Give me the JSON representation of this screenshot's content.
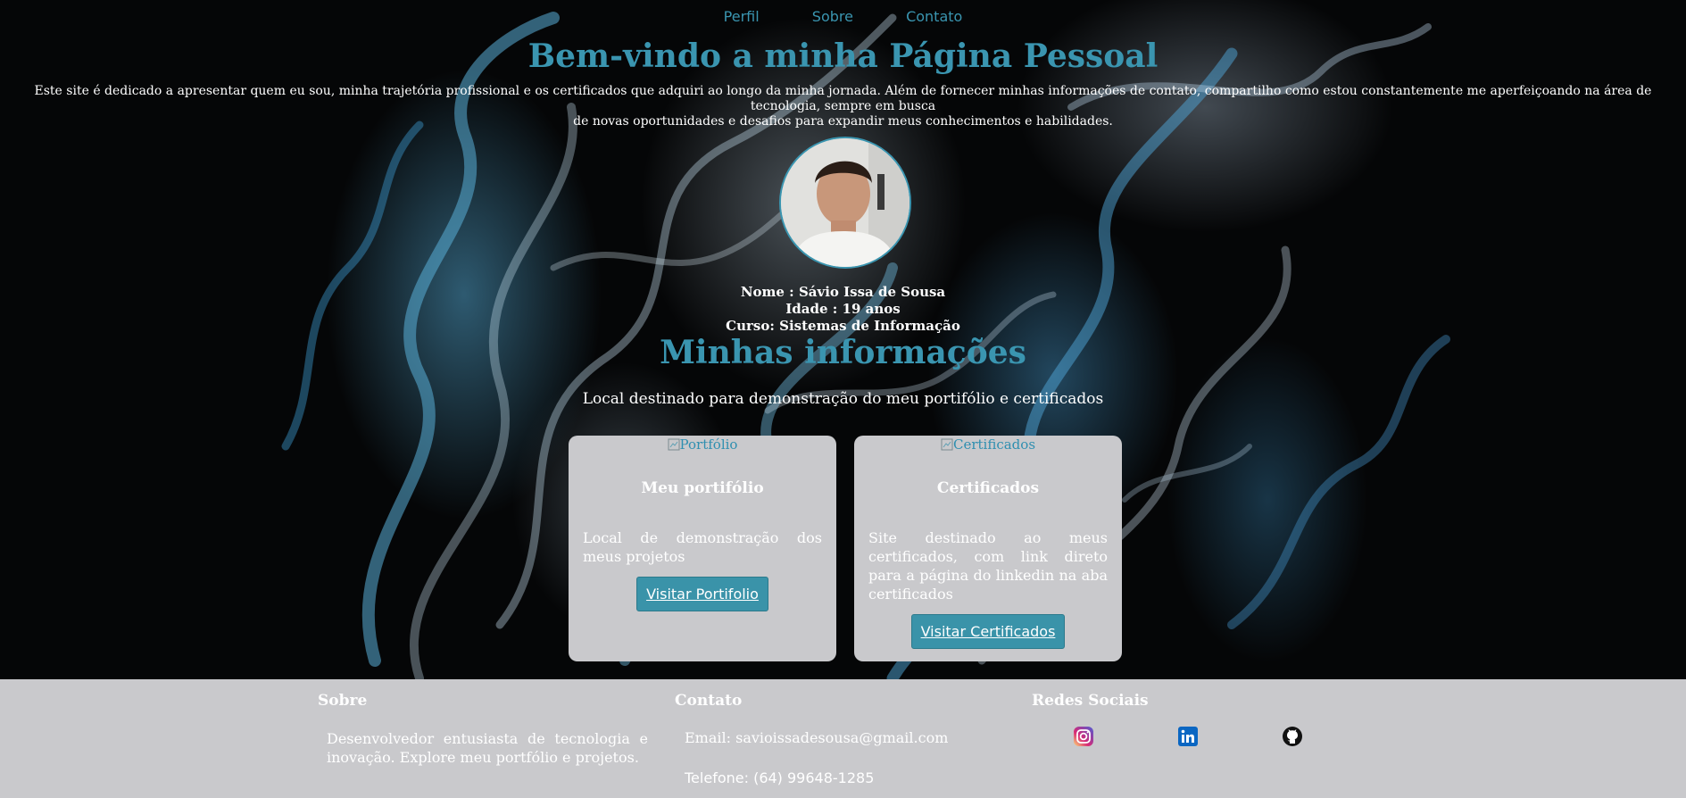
{
  "nav": {
    "items": [
      "Perfil",
      "Sobre",
      "Contato"
    ]
  },
  "hero": {
    "title": "Bem-vindo a minha Página Pessoal",
    "intro_line1": "Este site é dedicado a apresentar quem eu sou, minha trajetória profissional e os certificados que adquiri ao longo da minha jornada. Além de fornecer minhas informações de contato, compartilho como estou constantemente me aperfeiçoando na área de tecnologia, sempre em busca",
    "intro_line2": "de novas oportunidades e desafios para expandir meus conhecimentos e habilidades."
  },
  "profile": {
    "name": "Nome : Sávio Issa de Sousa",
    "age": "Idade : 19 anos",
    "course": "Curso: Sistemas de Informação"
  },
  "section": {
    "title": "Minhas informações",
    "subtitle": "Local destinado para demonstração do meu portifólio e certificados"
  },
  "cards": [
    {
      "img_alt": "Portfólio",
      "title": "Meu portifólio",
      "text": "Local de demonstração dos meus projetos",
      "button": "Visitar Portifolio"
    },
    {
      "img_alt": "Certificados",
      "title": "Certificados",
      "text": "Site destinado ao meus certificados, com link direto para a página do linkedin na aba certificados",
      "button": "Visitar Certificados"
    }
  ],
  "footer": {
    "about_title": "Sobre",
    "about_text": "Desenvolvedor entusiasta de tecnologia e inovação. Explore meu portfólio e projetos.",
    "contact_title": "Contato",
    "email": "Email: savioissadesousa@gmail.com",
    "phone": "Telefone: (64) 99648-1285",
    "social_title": "Redes Sociais",
    "social_icons": [
      "instagram-icon",
      "linkedin-icon",
      "github-icon"
    ]
  },
  "colors": {
    "accent": "#3a95b0",
    "card_bg": "#c9c9cc",
    "button_bg": "#3a93a9",
    "footer_bg": "#c9c9cc"
  }
}
